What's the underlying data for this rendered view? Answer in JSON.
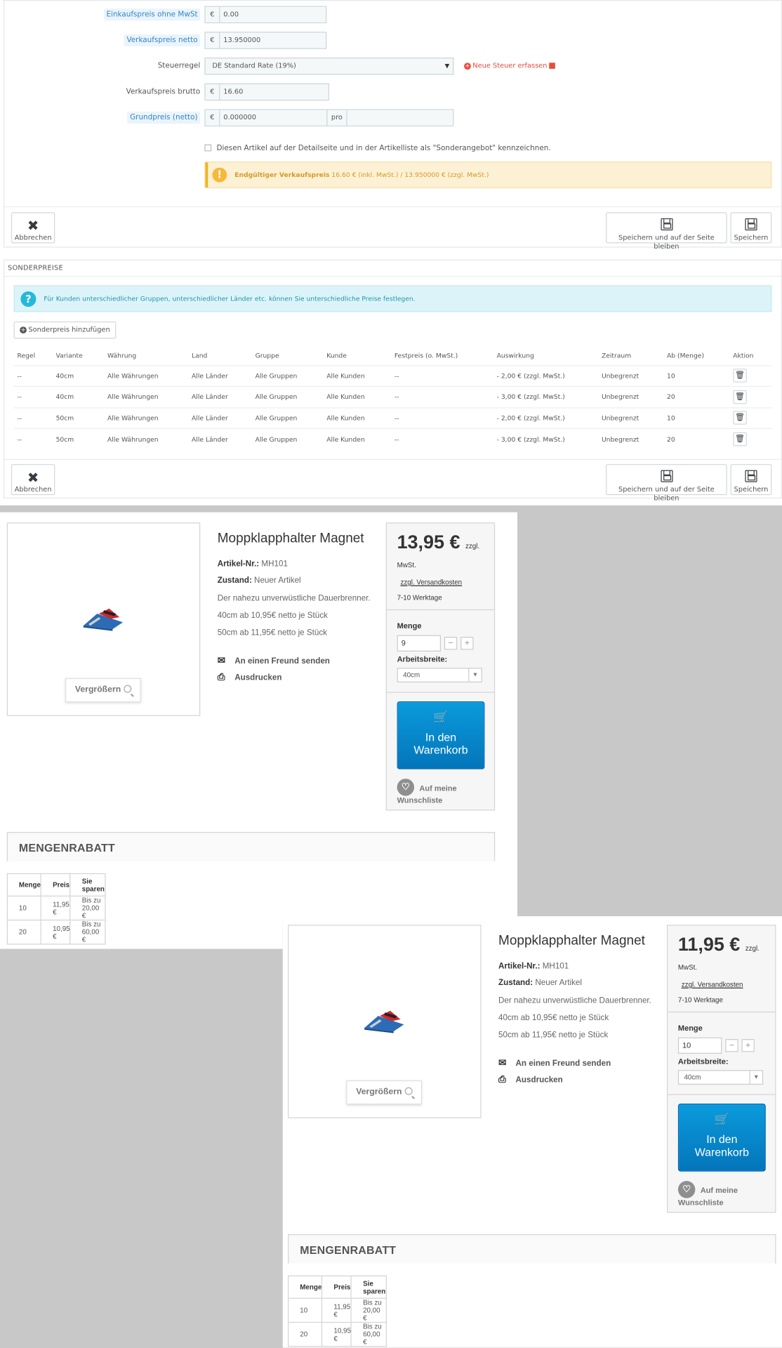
{
  "admin": {
    "pricing": {
      "purchase_label": "Einkaufspreis ohne MwSt",
      "purchase_currency": "€",
      "purchase_value": "0.00",
      "net_label": "Verkaufspreis netto",
      "net_currency": "€",
      "net_value": "13.950000",
      "tax_label": "Steuerregel",
      "tax_value": "DE Standard Rate (19%)",
      "new_tax_link": "Neue Steuer erfassen",
      "gross_label": "Verkaufspreis brutto",
      "gross_currency": "€",
      "gross_value": "16.60",
      "unit_label": "Grundpreis (netto)",
      "unit_currency": "€",
      "unit_value": "0.000000",
      "unit_per": "pro",
      "unit_per_value": "",
      "special_offer_checkbox": "Diesen Artikel auf der Detailseite und in der Artikelliste als \"Sonderangebot\" kennzeichnen.",
      "final_price_label": "Endgültiger Verkaufspreis",
      "final_price_text": "16.60 € (inkl. MwSt.) / 13.950000 € (zzgl. MwSt.)"
    },
    "buttons": {
      "cancel": "Abbrechen",
      "save_stay": "Speichern und auf der Seite bleiben",
      "save": "Speichern"
    },
    "special_prices": {
      "title": "SONDERPREISE",
      "info": "Für Kunden unterschiedlicher Gruppen, unterschiedlicher Länder etc. können Sie unterschiedliche Preise festlegen.",
      "add_button": "Sonderpreis hinzufügen",
      "columns": [
        "Regel",
        "Variante",
        "Währung",
        "Land",
        "Gruppe",
        "Kunde",
        "Festpreis (o. MwSt.)",
        "Auswirkung",
        "Zeitraum",
        "Ab (Menge)",
        "Aktion"
      ],
      "rows": [
        [
          "--",
          "40cm",
          "Alle Währungen",
          "Alle Länder",
          "Alle Gruppen",
          "Alle Kunden",
          "--",
          "- 2,00 € (zzgl. MwSt.)",
          "Unbegrenzt",
          "10"
        ],
        [
          "--",
          "40cm",
          "Alle Währungen",
          "Alle Länder",
          "Alle Gruppen",
          "Alle Kunden",
          "--",
          "- 3,00 € (zzgl. MwSt.)",
          "Unbegrenzt",
          "20"
        ],
        [
          "--",
          "50cm",
          "Alle Währungen",
          "Alle Länder",
          "Alle Gruppen",
          "Alle Kunden",
          "--",
          "- 2,00 € (zzgl. MwSt.)",
          "Unbegrenzt",
          "10"
        ],
        [
          "--",
          "50cm",
          "Alle Währungen",
          "Alle Länder",
          "Alle Gruppen",
          "Alle Kunden",
          "--",
          "- 3,00 € (zzgl. MwSt.)",
          "Unbegrenzt",
          "20"
        ]
      ]
    }
  },
  "shop1": {
    "title": "Moppklapphalter Magnet",
    "sku_label": "Artikel-Nr.:",
    "sku": "MH101",
    "condition_label": "Zustand:",
    "condition": "Neuer Artikel",
    "desc1": "Der nahezu unverwüstliche Dauerbrenner.",
    "desc2": "40cm ab 10,95€ netto je Stück",
    "desc3": "50cm ab 11,95€ netto je Stück",
    "send_friend": "An einen Freund senden",
    "print": "Ausdrucken",
    "zoom": "Vergrößern",
    "price": "13,95 €",
    "price_suffix": "zzgl.",
    "vat": "MwSt.",
    "shipping": "zzgl. Versandkosten",
    "delivery": "7-10 Werktage",
    "qty_label": "Menge",
    "qty_value": "9",
    "width_label": "Arbeitsbreite:",
    "width_value": "40cm",
    "cart_line1": "In den",
    "cart_line2": "Warenkorb",
    "wish_line1": "Auf meine",
    "wish_line2": "Wunschliste",
    "discount_title": "MENGENRABATT",
    "discount_columns": [
      "Menge",
      "Preis",
      "Sie sparen"
    ],
    "discount_rows": [
      [
        "10",
        "11,95 €",
        "Bis zu 20,00 €"
      ],
      [
        "20",
        "10,95 €",
        "Bis zu 60,00 €"
      ]
    ]
  },
  "shop2": {
    "title": "Moppklapphalter Magnet",
    "sku_label": "Artikel-Nr.:",
    "sku": "MH101",
    "condition_label": "Zustand:",
    "condition": "Neuer Artikel",
    "desc1": "Der nahezu unverwüstliche Dauerbrenner.",
    "desc2": "40cm ab 10,95€ netto je Stück",
    "desc3": "50cm ab 11,95€ netto je Stück",
    "send_friend": "An einen Freund senden",
    "print": "Ausdrucken",
    "zoom": "Vergrößern",
    "price": "11,95 €",
    "price_suffix": "zzgl.",
    "vat": "MwSt.",
    "shipping": "zzgl. Versandkosten",
    "delivery": "7-10 Werktage",
    "qty_label": "Menge",
    "qty_value": "10",
    "width_label": "Arbeitsbreite:",
    "width_value": "40cm",
    "cart_line1": "In den",
    "cart_line2": "Warenkorb",
    "wish_line1": "Auf meine",
    "wish_line2": "Wunschliste",
    "discount_title": "MENGENRABATT",
    "discount_columns": [
      "Menge",
      "Preis",
      "Sie sparen"
    ],
    "discount_rows": [
      [
        "10",
        "11,95 €",
        "Bis zu 20,00 €"
      ],
      [
        "20",
        "10,95 €",
        "Bis zu 60,00 €"
      ]
    ]
  },
  "colors": {
    "accent_blue": "#0a8bd0",
    "warning": "#f0b322",
    "info": "#25b9d7",
    "danger": "#e74c3c",
    "background_gray": "#c8c8c8"
  }
}
